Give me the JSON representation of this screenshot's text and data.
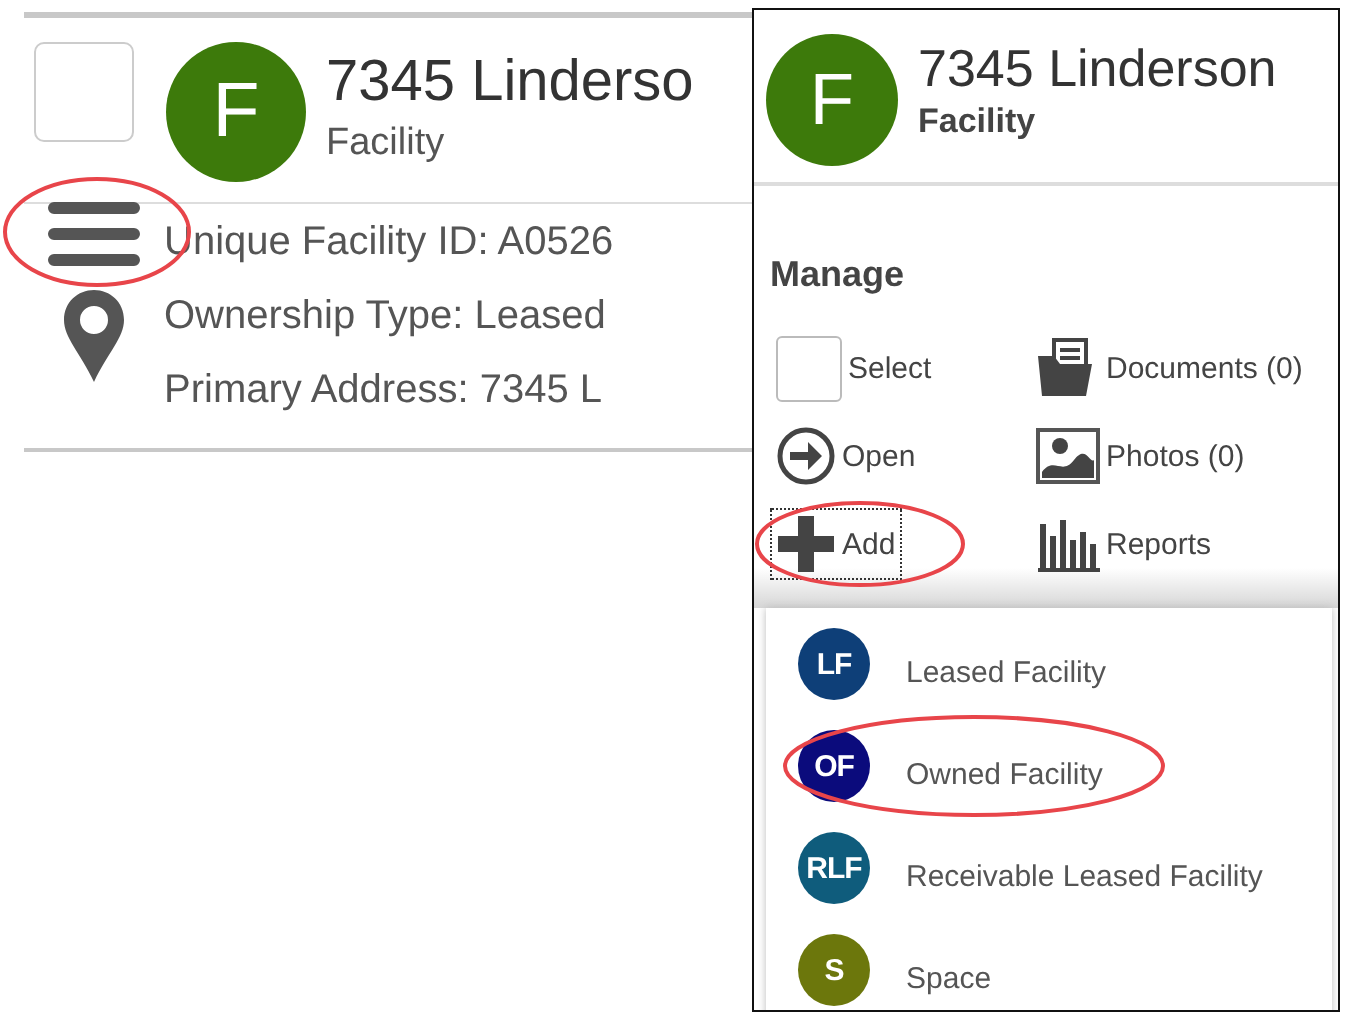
{
  "record": {
    "checked": false,
    "avatar": "F",
    "title": "7345 Linderso",
    "subtitle": "Facility",
    "menu_annotated": true,
    "details": [
      "Unique Facility ID: A0526",
      "Ownership Type: Leased",
      "Primary Address: 7345 L"
    ]
  },
  "panel": {
    "avatar": "F",
    "title": "7345 Linderson",
    "subtitle": "Facility",
    "section": "Manage",
    "actions": [
      {
        "kind": "checkbox",
        "label": "Select",
        "checked": false
      },
      {
        "kind": "documents",
        "label": "Documents (0)"
      },
      {
        "kind": "open",
        "label": "Open"
      },
      {
        "kind": "photos",
        "label": "Photos (0)"
      },
      {
        "kind": "add",
        "label": "Add",
        "focused": true,
        "annotated": true
      },
      {
        "kind": "reports",
        "label": "Reports"
      }
    ],
    "add_menu": [
      {
        "badge": "LF",
        "label": "Leased Facility",
        "color": "#0e3f78",
        "annotated": false
      },
      {
        "badge": "OF",
        "label": "Owned Facility",
        "color": "#0b0b7c",
        "annotated": true
      },
      {
        "badge": "RLF",
        "label": "Receivable Leased Facility",
        "color": "#0f5c7c",
        "annotated": false
      },
      {
        "badge": "S",
        "label": "Space",
        "color": "#6c770c",
        "annotated": false
      }
    ]
  }
}
